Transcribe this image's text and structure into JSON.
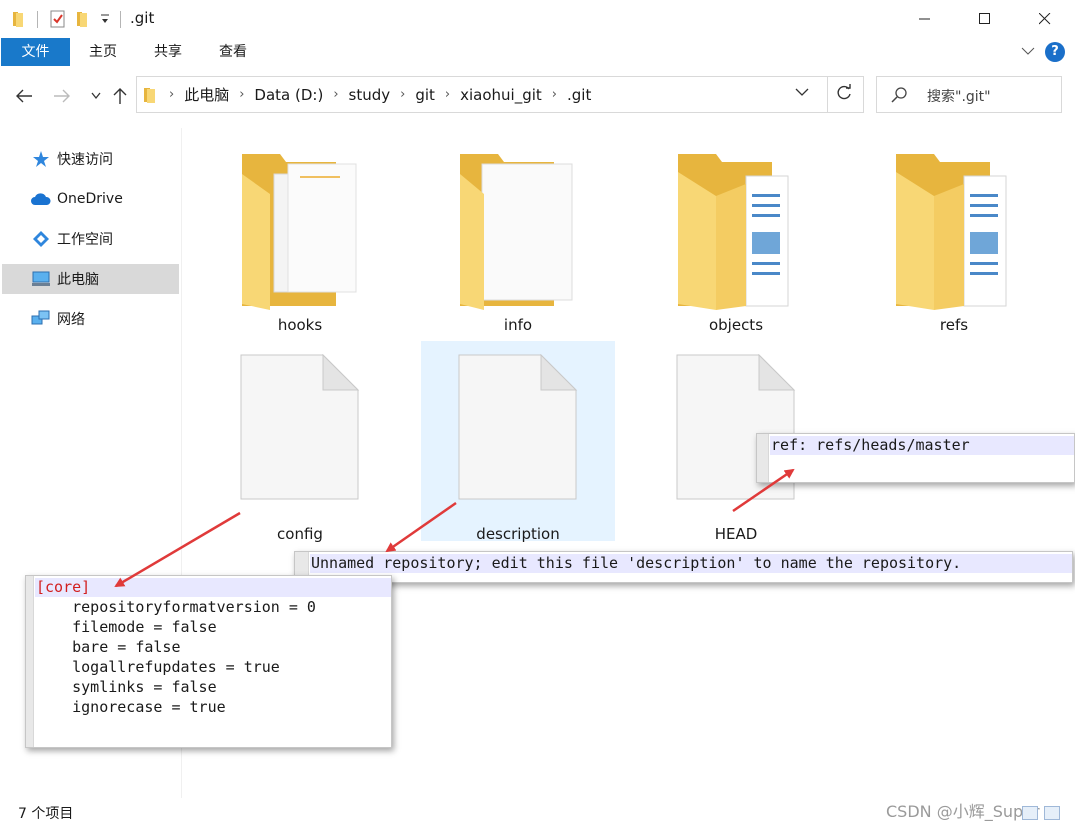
{
  "window": {
    "title": ".git",
    "minimize_icon": "minimize-icon",
    "maximize_icon": "maximize-icon",
    "close_icon": "close-icon"
  },
  "ribbon": {
    "tabs": [
      {
        "label": "文件",
        "active": true
      },
      {
        "label": "主页"
      },
      {
        "label": "共享"
      },
      {
        "label": "查看"
      }
    ],
    "help_label": "?"
  },
  "address": {
    "breadcrumbs": [
      "此电脑",
      "Data (D:)",
      "study",
      "git",
      "xiaohui_git",
      ".git"
    ]
  },
  "search": {
    "placeholder": "搜索\".git\""
  },
  "sidebar": {
    "items": [
      {
        "label": "快速访问",
        "icon": "star-icon"
      },
      {
        "label": "OneDrive",
        "icon": "cloud-icon"
      },
      {
        "label": "工作空间",
        "icon": "workspace-icon"
      },
      {
        "label": "此电脑",
        "icon": "computer-icon",
        "selected": true
      },
      {
        "label": "网络",
        "icon": "network-icon"
      }
    ]
  },
  "files": [
    {
      "name": "hooks",
      "type": "folder"
    },
    {
      "name": "info",
      "type": "folder"
    },
    {
      "name": "objects",
      "type": "folder"
    },
    {
      "name": "refs",
      "type": "folder"
    },
    {
      "name": "config",
      "type": "file"
    },
    {
      "name": "description",
      "type": "file",
      "highlighted": true
    },
    {
      "name": "HEAD",
      "type": "file"
    }
  ],
  "status": {
    "item_count": "7 个项目"
  },
  "watermark": "CSDN @小辉_Super",
  "popups": {
    "head": {
      "lines": [
        "ref: refs/heads/master"
      ]
    },
    "description": {
      "lines": [
        "Unnamed repository; edit this file 'description' to name the repository."
      ]
    },
    "config": {
      "section": "[core]",
      "lines": [
        "    repositoryformatversion = 0",
        "    filemode = false",
        "    bare = false",
        "    logallrefupdates = true",
        "    symlinks = false",
        "    ignorecase = true"
      ]
    }
  },
  "colors": {
    "accent": "#1979ca",
    "arrow": "#e03a3a",
    "selection": "#e5f3ff",
    "folder": "#f8d775"
  }
}
